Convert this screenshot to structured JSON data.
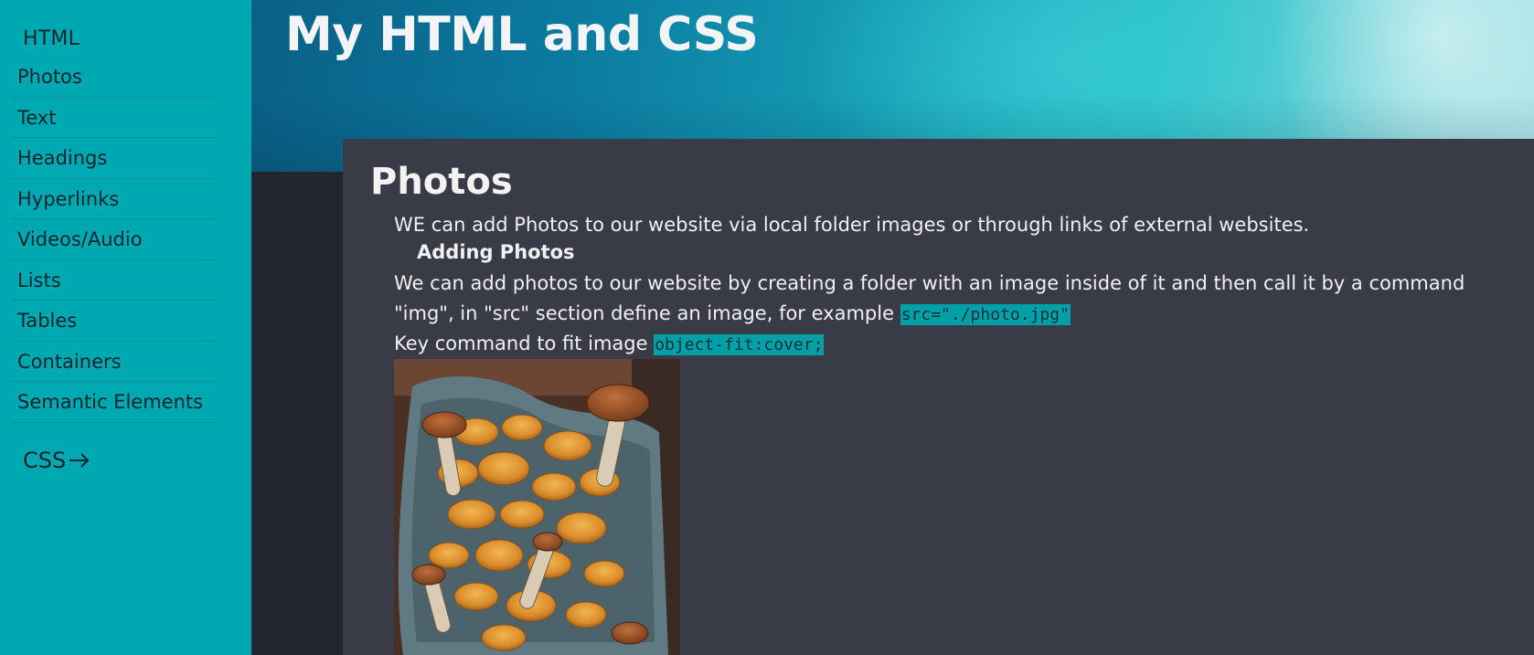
{
  "sidebar": {
    "heading": "HTML",
    "items": [
      {
        "label": "Photos"
      },
      {
        "label": "Text"
      },
      {
        "label": "Headings"
      },
      {
        "label": "Hyperlinks"
      },
      {
        "label": "Videos/Audio"
      },
      {
        "label": "Lists"
      },
      {
        "label": "Tables"
      },
      {
        "label": "Containers"
      },
      {
        "label": "Semantic Elements"
      }
    ],
    "css_link": "CSS",
    "css_icon": "arrow-right-icon"
  },
  "header": {
    "title": "My HTML and CSS"
  },
  "main": {
    "section_title": "Photos",
    "intro": "WE can add Photos to our website via local folder images or through links of external websites.",
    "subheading": "Adding Photos",
    "para_line1": "We can add photos to our website by creating a folder with an image inside of it and then call it by a command",
    "para_line2": "\"img\", in \"src\" section define an image, for example ",
    "code_src": "src=\"./photo.jpg\"",
    "key_command": "Key command to fit image ",
    "code_fit": "object-fit:cover;",
    "photo_subject": "mushrooms-photo"
  },
  "colors": {
    "sidebar_bg": "#00a8b1",
    "card_bg": "#393b46",
    "page_bg": "#22262f",
    "code_bg": "#00a0a8"
  }
}
